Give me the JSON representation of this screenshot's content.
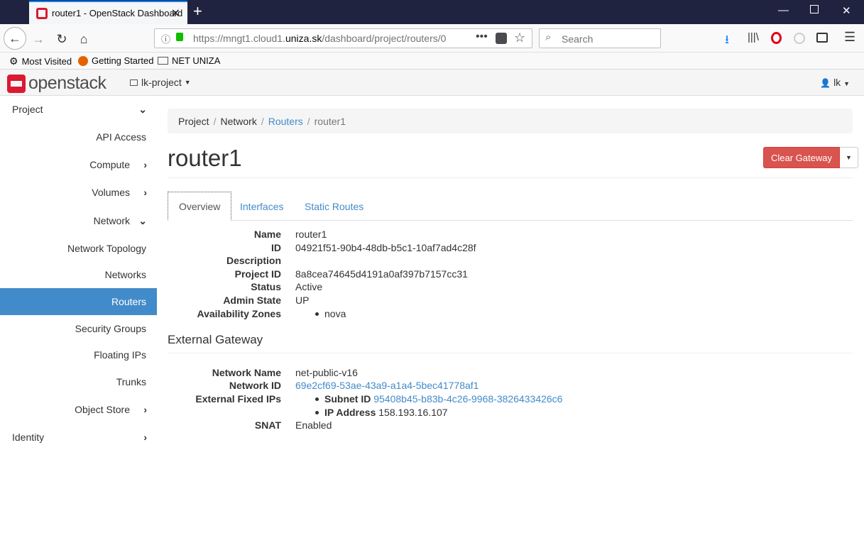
{
  "browser": {
    "tab_title": "router1 - OpenStack Dashboard",
    "url_prefix": "https://mngt1.cloud1.",
    "url_domain": "uniza.sk",
    "url_rest": "/dashboard/project/routers/0",
    "search_placeholder": "Search",
    "bookmarks": [
      "Most Visited",
      "Getting Started",
      "NET UNIZA"
    ]
  },
  "header": {
    "logo_text": "openstack",
    "project": "lk-project",
    "user": "lk"
  },
  "sidebar": {
    "items": [
      {
        "label": "Project"
      },
      {
        "label": "API Access"
      },
      {
        "label": "Compute"
      },
      {
        "label": "Volumes"
      },
      {
        "label": "Network"
      },
      {
        "label": "Network Topology"
      },
      {
        "label": "Networks"
      },
      {
        "label": "Routers"
      },
      {
        "label": "Security Groups"
      },
      {
        "label": "Floating IPs"
      },
      {
        "label": "Trunks"
      },
      {
        "label": "Object Store"
      },
      {
        "label": "Identity"
      }
    ]
  },
  "breadcrumb": [
    "Project",
    "Network",
    "Routers",
    "router1"
  ],
  "page": {
    "title": "router1",
    "clear_gateway": "Clear Gateway"
  },
  "tabs": [
    "Overview",
    "Interfaces",
    "Static Routes"
  ],
  "overview": {
    "name_label": "Name",
    "name": "router1",
    "id_label": "ID",
    "id": "04921f51-90b4-48db-b5c1-10af7ad4c28f",
    "description_label": "Description",
    "project_id_label": "Project ID",
    "project_id": "8a8cea74645d4191a0af397b7157cc31",
    "status_label": "Status",
    "status": "Active",
    "admin_state_label": "Admin State",
    "admin_state": "UP",
    "az_label": "Availability Zones",
    "az": "nova"
  },
  "gateway": {
    "section_title": "External Gateway",
    "network_name_label": "Network Name",
    "network_name": "net-public-v16",
    "network_id_label": "Network ID",
    "network_id": "69e2cf69-53ae-43a9-a1a4-5bec41778af1",
    "fixed_ips_label": "External Fixed IPs",
    "subnet_id_label": "Subnet ID",
    "subnet_id": "95408b45-b83b-4c26-9968-3826433426c6",
    "ip_address_label": "IP Address",
    "ip_address": "158.193.16.107",
    "snat_label": "SNAT",
    "snat": "Enabled"
  }
}
